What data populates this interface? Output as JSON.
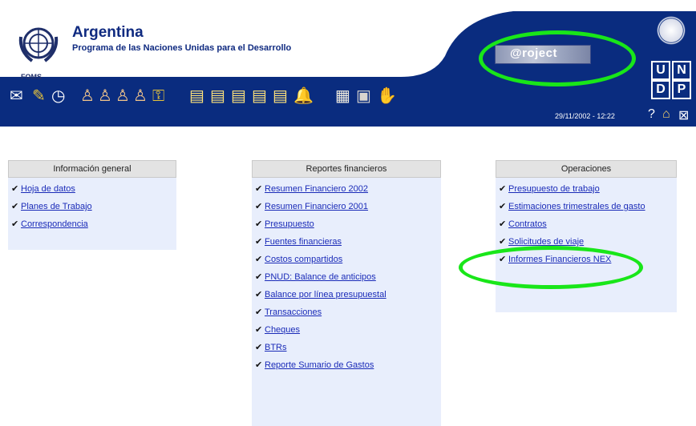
{
  "header": {
    "country": "Argentina",
    "program": "Programa de las Naciones Unidas para el Desarrollo",
    "logo_label": "FOMS",
    "project_label": "@roject",
    "undp_letters": [
      "U",
      "N",
      "D",
      "P"
    ],
    "timestamp": "29/11/2002 - 12:22",
    "toolbar_icons": [
      "mail-icon",
      "pen-icon",
      "clock-icon",
      "person-icon",
      "person-icon",
      "person-icon",
      "person-icon",
      "key-icon",
      "document-icon",
      "document-icon",
      "document-icon",
      "document-icon",
      "document-icon",
      "bell-icon",
      "notebook-icon",
      "folder-icon",
      "handshake-icon"
    ],
    "corner_icons": [
      "help-icon",
      "home-icon",
      "exit-icon"
    ]
  },
  "colors": {
    "header_blue": "#0a2c7f",
    "annotation_green": "#19e619",
    "panel_bg": "#e8eefc",
    "link": "#1a2bb8"
  },
  "panels": [
    {
      "title": "Información general",
      "items": [
        "Hoja de datos",
        "Planes de Trabajo",
        "Correspondencia"
      ]
    },
    {
      "title": "Reportes financieros",
      "items": [
        "Resumen Financiero 2002",
        "Resumen Financiero 2001",
        "Presupuesto",
        "Fuentes financieras",
        "Costos compartidos",
        "PNUD: Balance de anticipos",
        "Balance por línea presupuestal",
        "Transacciones",
        "Cheques",
        "BTRs",
        "Reporte Sumario de Gastos"
      ]
    },
    {
      "title": "Operaciones",
      "items": [
        "Presupuesto de trabajo",
        "Estimaciones trimestrales de gasto",
        "Contratos",
        "Solicitudes de viaje",
        "Informes Financieros NEX"
      ]
    }
  ]
}
